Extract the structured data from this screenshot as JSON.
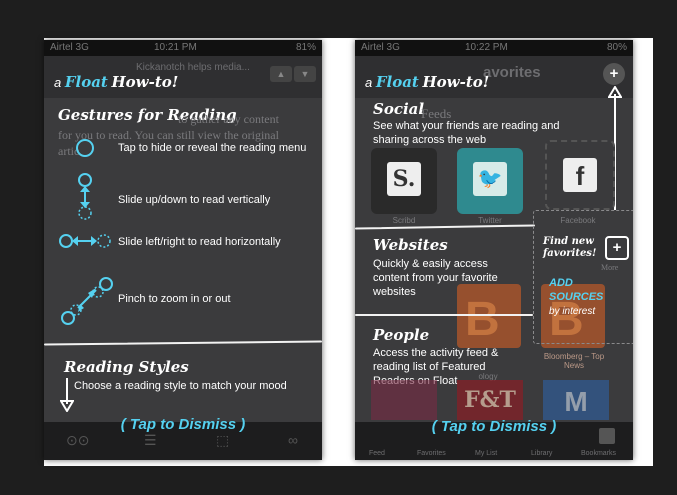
{
  "left": {
    "status": {
      "carrier": "Airtel 3G",
      "time": "10:21 PM",
      "battery": "81%"
    },
    "bg_title": "Kickanotch helps media...",
    "header": {
      "prefix": "a",
      "brand": "Float",
      "suffix": "How-to!"
    },
    "gestures": {
      "title": "Gestures for Reading",
      "items": [
        {
          "icon": "tap-gesture-icon",
          "text": "Tap to hide or reveal the reading menu"
        },
        {
          "icon": "vertical-slide-gesture-icon",
          "text": "Slide up/down to read vertically"
        },
        {
          "icon": "horizontal-slide-gesture-icon",
          "text": "Slide left/right to read horizontally"
        },
        {
          "icon": "pinch-gesture-icon",
          "text": "Pinch to zoom in or out"
        }
      ],
      "bg_text_1": "to gather any content",
      "bg_text_2": "for you to read. You can still view the original",
      "bg_text_3": "artic"
    },
    "styles": {
      "title": "Reading Styles",
      "text": "Choose a reading style to match your mood"
    },
    "dismiss": "( Tap to Dismiss )"
  },
  "right": {
    "status": {
      "carrier": "Airtel 3G",
      "time": "10:22 PM",
      "battery": "80%"
    },
    "bg_title": "avorites",
    "header": {
      "prefix": "a",
      "brand": "Float",
      "suffix": "How-to!"
    },
    "social": {
      "title": "Social",
      "text": "See what your friends are reading and sharing across the web"
    },
    "bg_section": "Feeds",
    "tiles": [
      {
        "name": "scribd-tile",
        "label": "Scribd",
        "glyph": "S.",
        "color": "#2a2a2a"
      },
      {
        "name": "twitter-tile",
        "label": "Twitter",
        "glyph": "🐦",
        "color": "#2f8a8f"
      },
      {
        "name": "facebook-tile",
        "label": "Facebook",
        "glyph": "f",
        "color": "#3a3a3c"
      }
    ],
    "websites": {
      "title": "Websites",
      "text": "Quickly & easily access content from your favorite websites"
    },
    "find_new": {
      "title": "Find new favorites!",
      "add_label": "ADD SOURCES",
      "by": "by interest"
    },
    "bg_more": "More",
    "people": {
      "title": "People",
      "text": "Access the activity feed & reading list of Featured Readers on Float"
    },
    "bg_tile_labels": {
      "tech": "ology",
      "bloomberg": "Bloomberg – Top News"
    },
    "dismiss": "( Tap to Dismiss )",
    "tabs": [
      "Feed",
      "Favorites",
      "My List",
      "Library",
      "Bookmarks"
    ]
  },
  "colors": {
    "accent": "#55d1f0",
    "panel": "#3b3b3d",
    "background": "#1e1e1e",
    "frame": "#ffffff"
  }
}
